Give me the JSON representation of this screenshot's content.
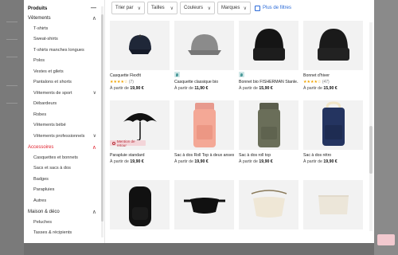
{
  "sidebar": {
    "sections": [
      {
        "label": "Produits",
        "head": true,
        "red": false,
        "chev": "—",
        "subs": []
      },
      {
        "label": "Vêtements",
        "head": false,
        "red": false,
        "chev": "∧",
        "subs": [
          {
            "label": "T-shirts"
          },
          {
            "label": "Sweat-shirts"
          },
          {
            "label": "T-shirts manches longues"
          },
          {
            "label": "Polos"
          },
          {
            "label": "Vestes et gilets"
          },
          {
            "label": "Pantalons et shorts"
          },
          {
            "label": "Vêtements de sport",
            "chev": "∨"
          },
          {
            "label": "Débardeurs"
          },
          {
            "label": "Robes"
          },
          {
            "label": "Vêtements bébé"
          },
          {
            "label": "Vêtements professionnels",
            "chev": "∨"
          }
        ]
      },
      {
        "label": "Accessoires",
        "head": false,
        "red": true,
        "chev": "∧",
        "subs": [
          {
            "label": "Casquettes et bonnets"
          },
          {
            "label": "Sacs et sacs à dos"
          },
          {
            "label": "Badges"
          },
          {
            "label": "Parapluies"
          },
          {
            "label": "Autres"
          }
        ]
      },
      {
        "label": "Maison & déco",
        "head": false,
        "red": false,
        "chev": "∧",
        "subs": [
          {
            "label": "Peluches"
          },
          {
            "label": "Tasses & récipients"
          }
        ]
      }
    ]
  },
  "filters": {
    "sort_label": "Trier par",
    "sizes_label": "Tailles",
    "colors_label": "Couleurs",
    "brands_label": "Marques",
    "more_label": "Plus de filtres",
    "arrow": "∨"
  },
  "products": [
    {
      "name": "Casquette Flexfit",
      "rating": "★★★★☆",
      "count": "(7)",
      "prefix": "À partir de ",
      "price": "19,90 €",
      "img": "cap-navy"
    },
    {
      "name": "Casquette classique bio",
      "prefix": "À partir de ",
      "price": "11,90 €",
      "img": "cap-grey",
      "eco": true
    },
    {
      "name": "Bonnet bio FISHERMAN Stanle...",
      "prefix": "À partir de ",
      "price": "15,90 €",
      "img": "beanie-black",
      "eco": true
    },
    {
      "name": "Bonnet d'hiver",
      "rating": "★★★★☆",
      "count": "(47)",
      "prefix": "À partir de ",
      "price": "15,90 €",
      "img": "beanie-black2"
    },
    {
      "name": "Parapluie standard",
      "prefix": "À partir de ",
      "price": "19,90 €",
      "img": "umbrella",
      "badge": "Mention de retour"
    },
    {
      "name": "Sac à dos Roll Top à deux anses",
      "prefix": "À partir de ",
      "price": "19,90 €",
      "img": "bag-pink"
    },
    {
      "name": "Sac à dos roll top",
      "prefix": "À partir de ",
      "price": "19,90 €",
      "img": "bag-olive"
    },
    {
      "name": "Sac à dos rétro",
      "prefix": "À partir de ",
      "price": "19,90 €",
      "img": "bag-navy"
    },
    {
      "name": "",
      "prefix": "",
      "price": "",
      "img": "backpack-black"
    },
    {
      "name": "",
      "prefix": "",
      "price": "",
      "img": "fannypack-black"
    },
    {
      "name": "",
      "prefix": "",
      "price": "",
      "img": "bag-cream"
    },
    {
      "name": "",
      "prefix": "",
      "price": "",
      "img": "pouch-cream"
    }
  ],
  "colors": {
    "accent": "#e0202d",
    "link": "#2a6ad8",
    "star": "#f0a400"
  }
}
